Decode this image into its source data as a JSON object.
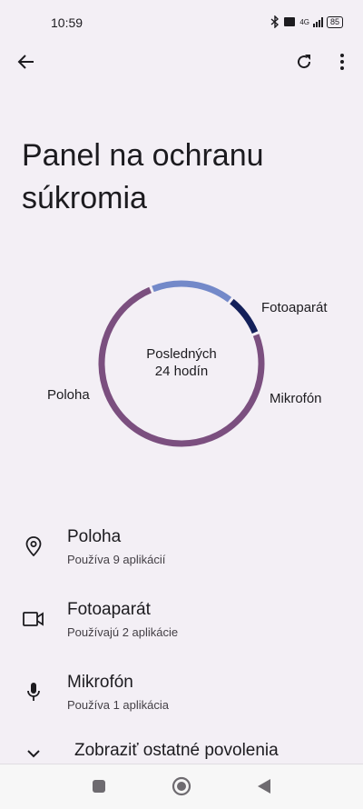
{
  "status_bar": {
    "time": "10:59",
    "network_label": "4G",
    "battery": "85"
  },
  "toolbar": {
    "back_icon": "arrow-left-icon",
    "refresh_icon": "refresh-icon",
    "more_icon": "more-vert-icon"
  },
  "page": {
    "title": "Panel na ochranu súkromia"
  },
  "chart_data": {
    "type": "pie",
    "center_label_line1": "Posledných",
    "center_label_line2": "24 hodín",
    "slices": [
      {
        "label": "Poloha",
        "value": 9,
        "color": "#7b4f7f"
      },
      {
        "label": "Fotoaparát",
        "value": 2,
        "color": "#7389c9"
      },
      {
        "label": "Mikrofón",
        "value": 1,
        "color": "#13205a"
      }
    ]
  },
  "permissions": [
    {
      "title": "Poloha",
      "subtitle": "Používa 9 aplikácií",
      "icon": "location-pin-icon"
    },
    {
      "title": "Fotoaparát",
      "subtitle": "Používajú 2 aplikácie",
      "icon": "video-camera-icon"
    },
    {
      "title": "Mikrofón",
      "subtitle": "Používa 1 aplikácia",
      "icon": "microphone-icon"
    }
  ],
  "more": {
    "label": "Zobraziť ostatné povolenia"
  },
  "nav": {
    "recents_icon": "square-icon",
    "home_icon": "circle-icon",
    "back_icon": "triangle-back-icon"
  }
}
